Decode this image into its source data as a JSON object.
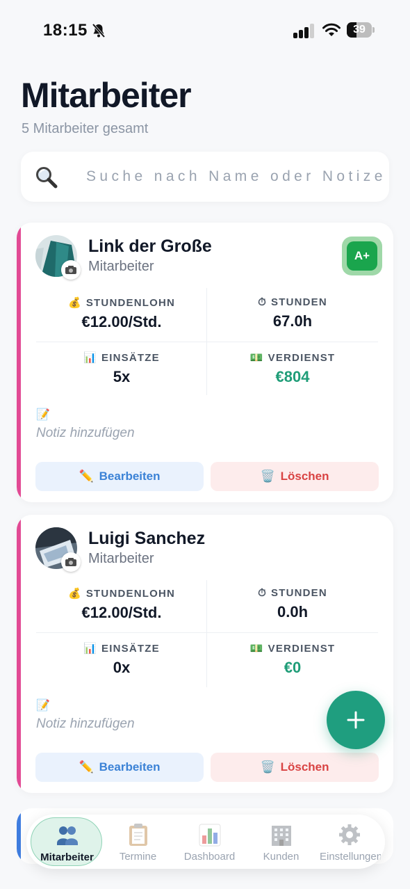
{
  "status_bar": {
    "time": "18:15",
    "battery": "39",
    "battery_level": 0.39
  },
  "header": {
    "title": "Mitarbeiter",
    "subtitle": "5 Mitarbeiter gesamt"
  },
  "search": {
    "placeholder": "Suche nach Name oder Notize",
    "value": ""
  },
  "employees": [
    {
      "name": "Link der Große",
      "role": "Mitarbeiter",
      "grade": "A+",
      "stats": {
        "wage_label": "STUNDENLOHN",
        "wage": "€12.00/Std.",
        "hours_label": "STUNDEN",
        "hours": "67.0h",
        "assignments_label": "EINSÄTZE",
        "assignments": "5x",
        "earnings_label": "VERDIENST",
        "earnings": "€804"
      },
      "note_placeholder": "Notiz hinzufügen",
      "edit_label": "Bearbeiten",
      "delete_label": "Löschen",
      "accent_color": "#e24a94"
    },
    {
      "name": "Luigi Sanchez",
      "role": "Mitarbeiter",
      "stats": {
        "wage_label": "STUNDENLOHN",
        "wage": "€12.00/Std.",
        "hours_label": "STUNDEN",
        "hours": "0.0h",
        "assignments_label": "EINSÄTZE",
        "assignments": "0x",
        "earnings_label": "VERDIENST",
        "earnings": "€0"
      },
      "note_placeholder": "Notiz hinzufügen",
      "edit_label": "Bearbeiten",
      "delete_label": "Löschen",
      "accent_color": "#e24a94"
    }
  ],
  "fab": {
    "icon": "plus-icon"
  },
  "tabbar": {
    "tabs": [
      {
        "label": "Mitarbeiter",
        "icon": "people-icon",
        "active": true
      },
      {
        "label": "Termine",
        "icon": "clipboard-icon",
        "active": false
      },
      {
        "label": "Dashboard",
        "icon": "bar-chart-icon",
        "active": false
      },
      {
        "label": "Kunden",
        "icon": "building-icon",
        "active": false
      },
      {
        "label": "Einstellungen",
        "icon": "gear-icon",
        "active": false
      }
    ]
  },
  "colors": {
    "accent_pink": "#e24a94",
    "accent_blue": "#3f7de0",
    "green": "#1f9e7f",
    "edit_blue": "#3b82d6",
    "delete_red": "#d94343"
  }
}
